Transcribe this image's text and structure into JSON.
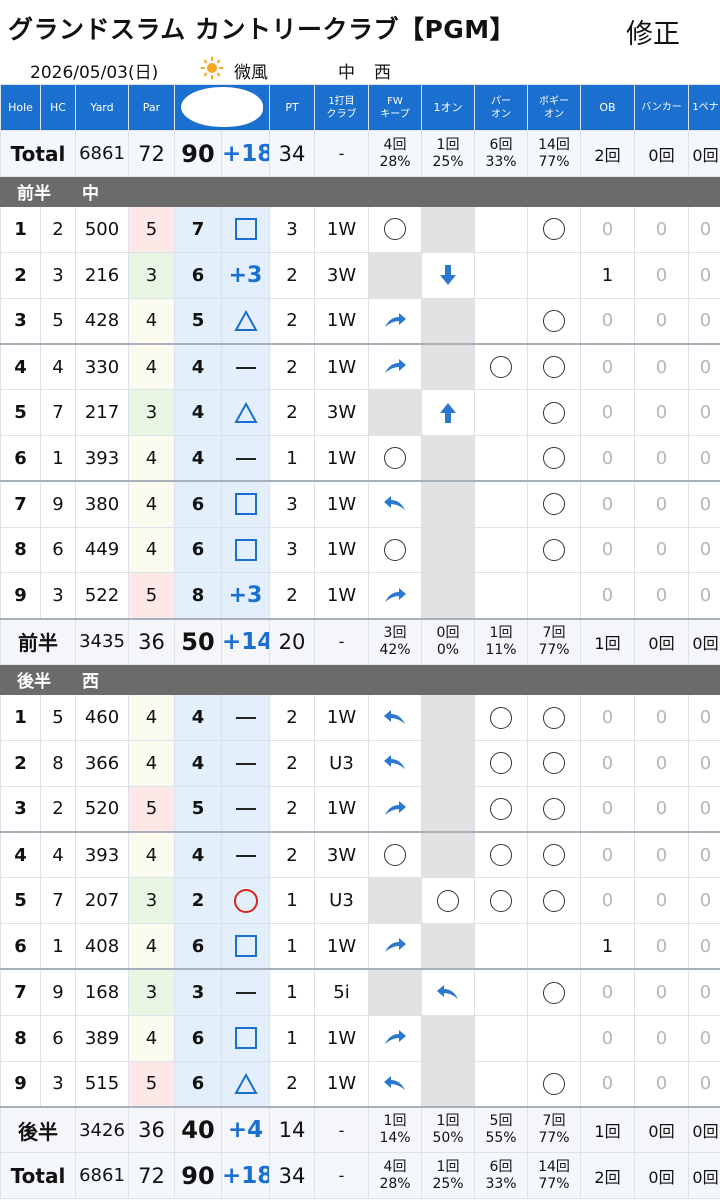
{
  "header": {
    "title": "グランドスラム カントリークラブ【PGM】",
    "edit_label": "修正",
    "date": "2026/05/03(日)",
    "weather_icon": "sun-icon",
    "wind": "微風",
    "course_front": "中",
    "course_back": "西"
  },
  "columns": [
    "Hole",
    "HC",
    "Yard",
    "Par",
    "",
    "PT",
    "1打目\nクラブ",
    "FW\nキープ",
    "1オン",
    "パー\nオン",
    "ボギー\nオン",
    "OB",
    "バンカー",
    "1ペナ"
  ],
  "total_top": {
    "label": "Total",
    "yard": "6861",
    "par": "72",
    "score": "90",
    "diff": "+18",
    "pt": "34",
    "club": "-",
    "fw": [
      "4回",
      "28%"
    ],
    "one_on": [
      "1回",
      "25%"
    ],
    "par_on": [
      "6回",
      "33%"
    ],
    "bogey_on": [
      "14回",
      "77%"
    ],
    "ob": "2回",
    "bunker": "0回",
    "pena": "0回"
  },
  "front": {
    "label": "前半",
    "course": "中",
    "holes": [
      {
        "no": "1",
        "hc": "2",
        "yard": "500",
        "par": "5",
        "score": "7",
        "mark": "square",
        "pt": "3",
        "club": "1W",
        "fw": "ring",
        "one_on": "grey",
        "par_on": "",
        "bogey_on": "ring",
        "ob": "0",
        "bunker": "0",
        "pena": "0"
      },
      {
        "no": "2",
        "hc": "3",
        "yard": "216",
        "par": "3",
        "score": "6",
        "mark": "+3",
        "pt": "2",
        "club": "3W",
        "fw": "grey",
        "one_on": "arrow-down",
        "par_on": "",
        "bogey_on": "",
        "ob": "1",
        "bunker": "0",
        "pena": "0"
      },
      {
        "no": "3",
        "hc": "5",
        "yard": "428",
        "par": "4",
        "score": "5",
        "mark": "triangle",
        "pt": "2",
        "club": "1W",
        "fw": "arrow-right",
        "one_on": "grey",
        "par_on": "",
        "bogey_on": "ring",
        "ob": "0",
        "bunker": "0",
        "pena": "0"
      },
      {
        "no": "4",
        "hc": "4",
        "yard": "330",
        "par": "4",
        "score": "4",
        "mark": "dash",
        "pt": "2",
        "club": "1W",
        "fw": "arrow-right",
        "one_on": "grey",
        "par_on": "ring",
        "bogey_on": "ring",
        "ob": "0",
        "bunker": "0",
        "pena": "0"
      },
      {
        "no": "5",
        "hc": "7",
        "yard": "217",
        "par": "3",
        "score": "4",
        "mark": "triangle",
        "pt": "2",
        "club": "3W",
        "fw": "grey",
        "one_on": "arrow-up",
        "par_on": "",
        "bogey_on": "ring",
        "ob": "0",
        "bunker": "0",
        "pena": "0"
      },
      {
        "no": "6",
        "hc": "1",
        "yard": "393",
        "par": "4",
        "score": "4",
        "mark": "dash",
        "pt": "1",
        "club": "1W",
        "fw": "ring",
        "one_on": "grey",
        "par_on": "",
        "bogey_on": "ring",
        "ob": "0",
        "bunker": "0",
        "pena": "0"
      },
      {
        "no": "7",
        "hc": "9",
        "yard": "380",
        "par": "4",
        "score": "6",
        "mark": "square",
        "pt": "3",
        "club": "1W",
        "fw": "arrow-left",
        "one_on": "grey",
        "par_on": "",
        "bogey_on": "ring",
        "ob": "0",
        "bunker": "0",
        "pena": "0"
      },
      {
        "no": "8",
        "hc": "6",
        "yard": "449",
        "par": "4",
        "score": "6",
        "mark": "square",
        "pt": "3",
        "club": "1W",
        "fw": "ring",
        "one_on": "grey",
        "par_on": "",
        "bogey_on": "ring",
        "ob": "0",
        "bunker": "0",
        "pena": "0"
      },
      {
        "no": "9",
        "hc": "3",
        "yard": "522",
        "par": "5",
        "score": "8",
        "mark": "+3",
        "pt": "2",
        "club": "1W",
        "fw": "arrow-right",
        "one_on": "grey",
        "par_on": "",
        "bogey_on": "",
        "ob": "0",
        "bunker": "0",
        "pena": "0"
      }
    ],
    "subtotal": {
      "label": "前半",
      "yard": "3435",
      "par": "36",
      "score": "50",
      "diff": "+14",
      "pt": "20",
      "club": "-",
      "fw": [
        "3回",
        "42%"
      ],
      "one_on": [
        "0回",
        "0%"
      ],
      "par_on": [
        "1回",
        "11%"
      ],
      "bogey_on": [
        "7回",
        "77%"
      ],
      "ob": "1回",
      "bunker": "0回",
      "pena": "0回"
    }
  },
  "back": {
    "label": "後半",
    "course": "西",
    "holes": [
      {
        "no": "1",
        "hc": "5",
        "yard": "460",
        "par": "4",
        "score": "4",
        "mark": "dash",
        "pt": "2",
        "club": "1W",
        "fw": "arrow-left",
        "one_on": "grey",
        "par_on": "ring",
        "bogey_on": "ring",
        "ob": "0",
        "bunker": "0",
        "pena": "0"
      },
      {
        "no": "2",
        "hc": "8",
        "yard": "366",
        "par": "4",
        "score": "4",
        "mark": "dash",
        "pt": "2",
        "club": "U3",
        "fw": "arrow-left",
        "one_on": "grey",
        "par_on": "ring",
        "bogey_on": "ring",
        "ob": "0",
        "bunker": "0",
        "pena": "0"
      },
      {
        "no": "3",
        "hc": "2",
        "yard": "520",
        "par": "5",
        "score": "5",
        "mark": "dash",
        "pt": "2",
        "club": "1W",
        "fw": "arrow-right",
        "one_on": "grey",
        "par_on": "ring",
        "bogey_on": "ring",
        "ob": "0",
        "bunker": "0",
        "pena": "0"
      },
      {
        "no": "4",
        "hc": "4",
        "yard": "393",
        "par": "4",
        "score": "4",
        "mark": "dash",
        "pt": "2",
        "club": "3W",
        "fw": "ring",
        "one_on": "grey",
        "par_on": "ring",
        "bogey_on": "ring",
        "ob": "0",
        "bunker": "0",
        "pena": "0"
      },
      {
        "no": "5",
        "hc": "7",
        "yard": "207",
        "par": "3",
        "score": "2",
        "mark": "circle",
        "pt": "1",
        "club": "U3",
        "fw": "grey",
        "one_on": "ring",
        "par_on": "ring",
        "bogey_on": "ring",
        "ob": "0",
        "bunker": "0",
        "pena": "0"
      },
      {
        "no": "6",
        "hc": "1",
        "yard": "408",
        "par": "4",
        "score": "6",
        "mark": "square",
        "pt": "1",
        "club": "1W",
        "fw": "arrow-right",
        "one_on": "grey",
        "par_on": "",
        "bogey_on": "",
        "ob": "1",
        "bunker": "0",
        "pena": "0"
      },
      {
        "no": "7",
        "hc": "9",
        "yard": "168",
        "par": "3",
        "score": "3",
        "mark": "dash",
        "pt": "1",
        "club": "5i",
        "fw": "grey",
        "one_on": "arrow-left",
        "par_on": "",
        "bogey_on": "ring",
        "ob": "0",
        "bunker": "0",
        "pena": "0"
      },
      {
        "no": "8",
        "hc": "6",
        "yard": "389",
        "par": "4",
        "score": "6",
        "mark": "square",
        "pt": "1",
        "club": "1W",
        "fw": "arrow-right",
        "one_on": "grey",
        "par_on": "",
        "bogey_on": "",
        "ob": "0",
        "bunker": "0",
        "pena": "0"
      },
      {
        "no": "9",
        "hc": "3",
        "yard": "515",
        "par": "5",
        "score": "6",
        "mark": "triangle",
        "pt": "2",
        "club": "1W",
        "fw": "arrow-left",
        "one_on": "grey",
        "par_on": "",
        "bogey_on": "ring",
        "ob": "0",
        "bunker": "0",
        "pena": "0"
      }
    ],
    "subtotal": {
      "label": "後半",
      "yard": "3426",
      "par": "36",
      "score": "40",
      "diff": "+4",
      "pt": "14",
      "club": "-",
      "fw": [
        "1回",
        "14%"
      ],
      "one_on": [
        "1回",
        "50%"
      ],
      "par_on": [
        "5回",
        "55%"
      ],
      "bogey_on": [
        "7回",
        "77%"
      ],
      "ob": "1回",
      "bunker": "0回",
      "pena": "0回"
    }
  },
  "total_bottom": {
    "label": "Total",
    "yard": "6861",
    "par": "72",
    "score": "90",
    "diff": "+18",
    "pt": "34",
    "club": "-",
    "fw": [
      "4回",
      "28%"
    ],
    "one_on": [
      "1回",
      "25%"
    ],
    "par_on": [
      "6回",
      "33%"
    ],
    "bogey_on": [
      "14回",
      "77%"
    ],
    "ob": "2回",
    "bunker": "0回",
    "pena": "0回"
  },
  "colors": {
    "accent": "#1b6fce",
    "section": "#6b6b6b",
    "eagle_red": "#d9261c"
  }
}
